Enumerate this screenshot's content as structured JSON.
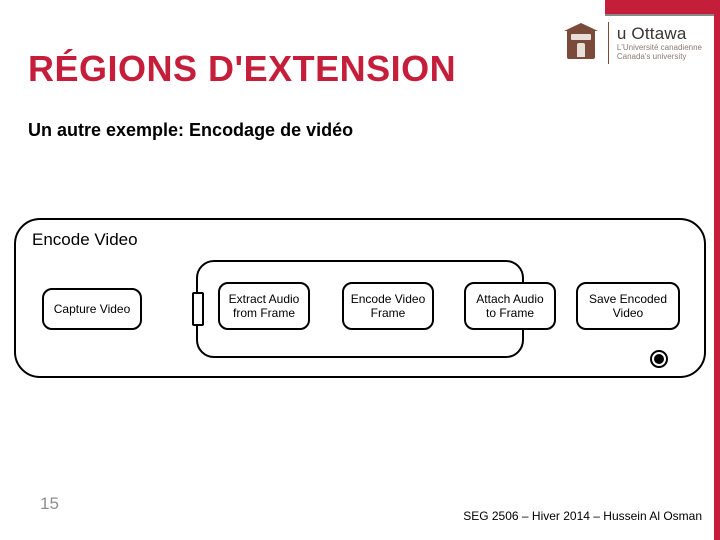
{
  "brand": {
    "name": "u Ottawa",
    "tagline1": "L'Université canadienne",
    "tagline2": "Canada's university"
  },
  "title": "RÉGIONS D'EXTENSION",
  "subtitle": "Un autre exemple: Encodage de vidéo",
  "diagram": {
    "region_label": "Encode Video",
    "nodes": {
      "capture": "Capture Video",
      "extract": "Extract Audio from Frame",
      "encode": "Encode Video Frame",
      "attach": "Attach Audio to Frame",
      "save": "Save Encoded Video"
    }
  },
  "page_number": "15",
  "footer": "SEG 2506 – Hiver 2014 – Hussein Al Osman"
}
